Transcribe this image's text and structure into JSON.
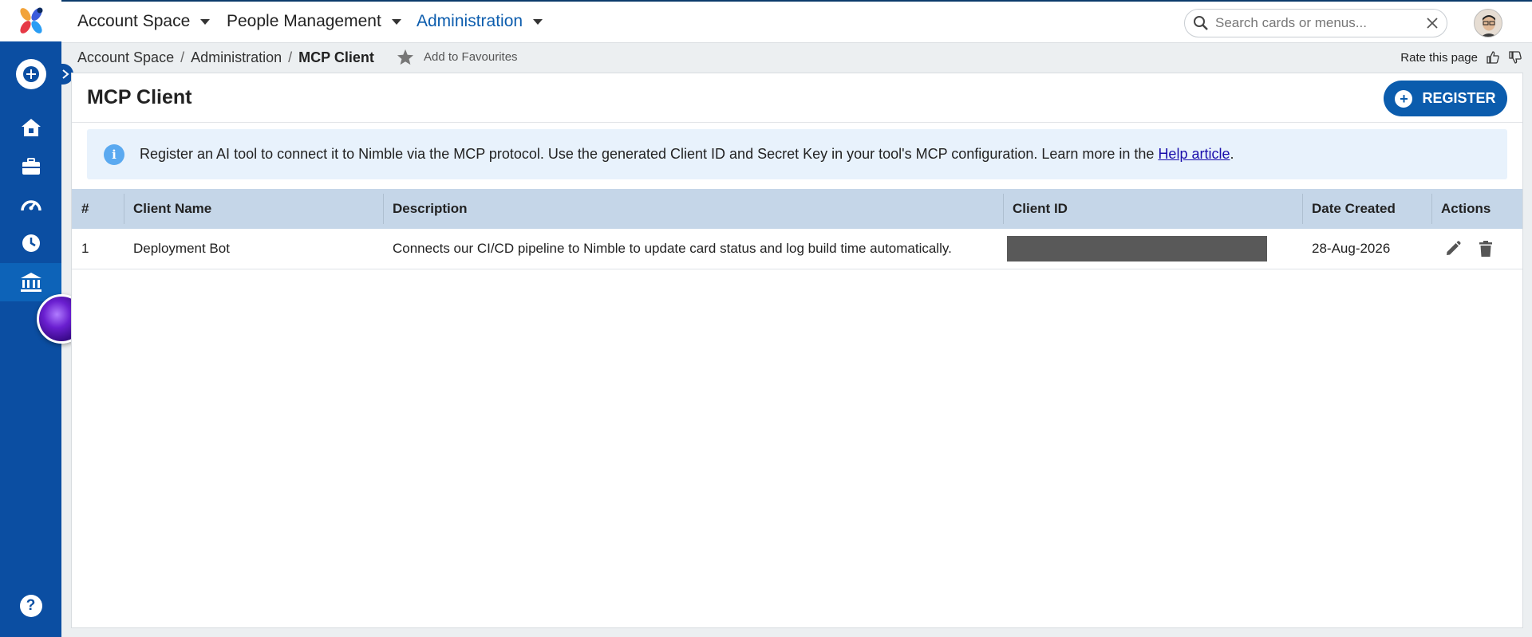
{
  "topbar": {
    "menus": [
      {
        "label": "Account Space"
      },
      {
        "label": "People Management"
      },
      {
        "label": "Administration"
      }
    ],
    "search_placeholder": "Search cards or menus..."
  },
  "breadcrumb": {
    "items": [
      "Account Space",
      "Administration"
    ],
    "current": "MCP Client",
    "separator": "/"
  },
  "favourites_label": "Add to Favourites",
  "rate_label": "Rate this page",
  "page": {
    "title": "MCP Client",
    "register_label": "REGISTER"
  },
  "info": {
    "text": "Register an AI tool to connect it to Nimble via the MCP protocol. Use the generated Client ID and Secret Key in your tool's MCP configuration. Learn more in the ",
    "link_text": "Help article",
    "suffix": "."
  },
  "table": {
    "headers": [
      "#",
      "Client Name",
      "Description",
      "Client ID",
      "Date Created",
      "Actions"
    ],
    "rows": [
      {
        "num": "1",
        "client_name": "Deployment Bot",
        "description": "Connects our CI/CD pipeline to Nimble to update card status and log build time automatically.",
        "date_created": "28-Aug-2026"
      }
    ]
  },
  "colors": {
    "sidebar": "#0b4ea2",
    "accent": "#0b5cad",
    "table_header": "#c5d6e8",
    "info_bg": "#e8f2fc"
  }
}
